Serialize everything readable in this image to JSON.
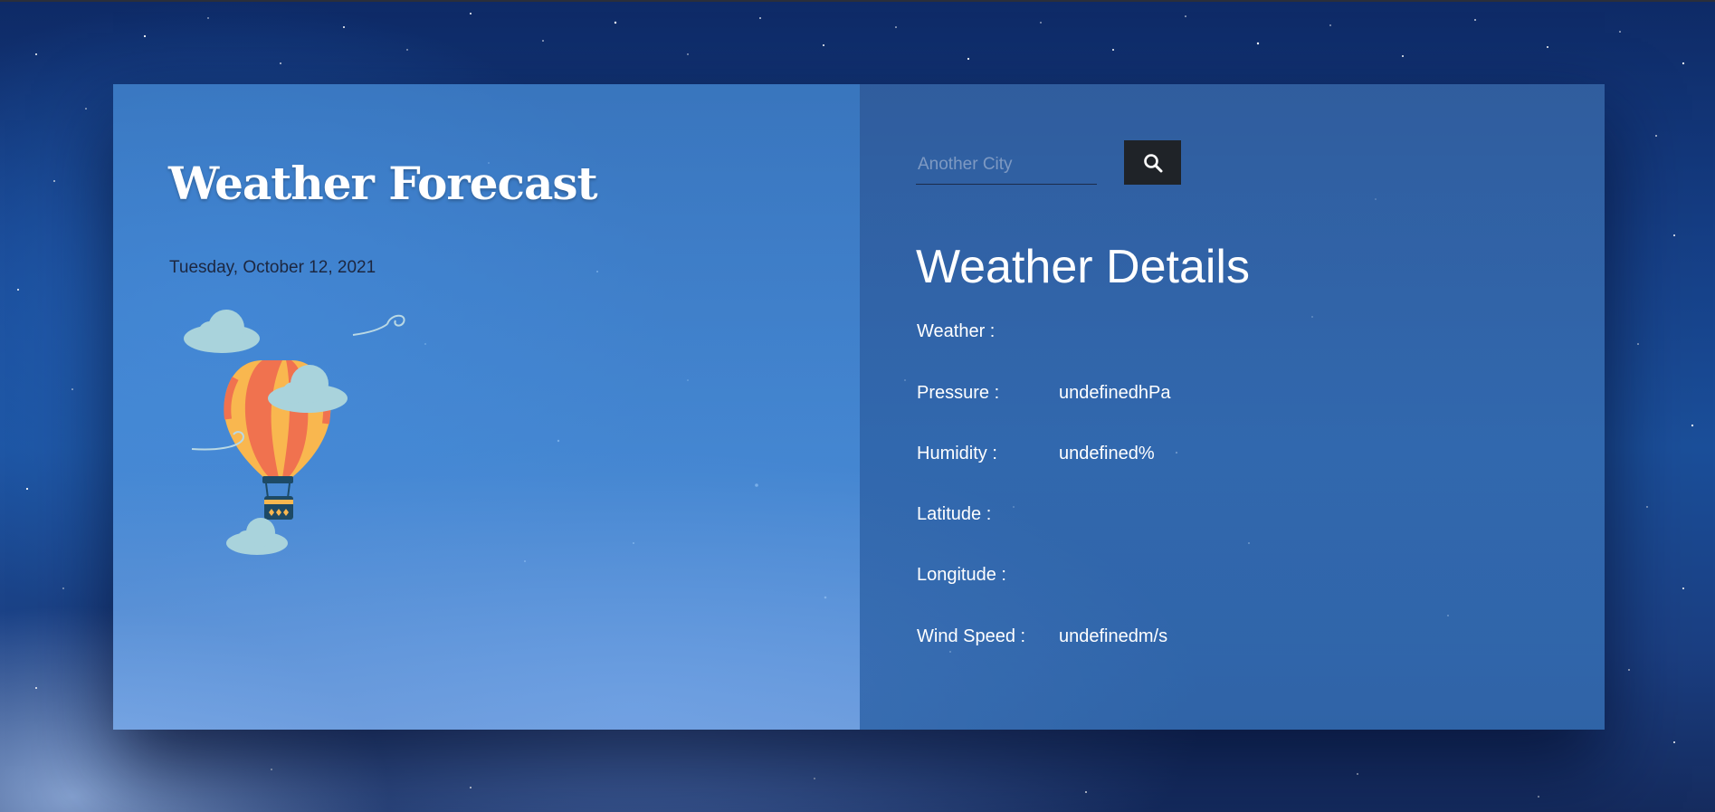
{
  "app": {
    "title": "Weather Forecast",
    "date": "Tuesday, October 12, 2021"
  },
  "search": {
    "placeholder": "Another City",
    "value": "",
    "button_icon": "search-icon"
  },
  "details": {
    "heading": "Weather Details",
    "rows": [
      {
        "label": "Weather :",
        "value": ""
      },
      {
        "label": "Pressure :",
        "value": "undefinedhPa"
      },
      {
        "label": "Humidity :",
        "value": "undefined%"
      },
      {
        "label": "Latitude :",
        "value": ""
      },
      {
        "label": "Longitude :",
        "value": ""
      },
      {
        "label": "Wind Speed :",
        "value": "undefinedm/s"
      }
    ]
  },
  "illustration": {
    "icon": "hot-air-balloon-icon",
    "colors": {
      "balloon_orange": "#f0724f",
      "balloon_yellow": "#f9b74f",
      "cloud": "#a9d3dc",
      "basket": "#1d4a66"
    }
  },
  "colors": {
    "search_button_bg": "#1f2328",
    "title_color": "#ffffff",
    "date_color": "#1c2740"
  }
}
